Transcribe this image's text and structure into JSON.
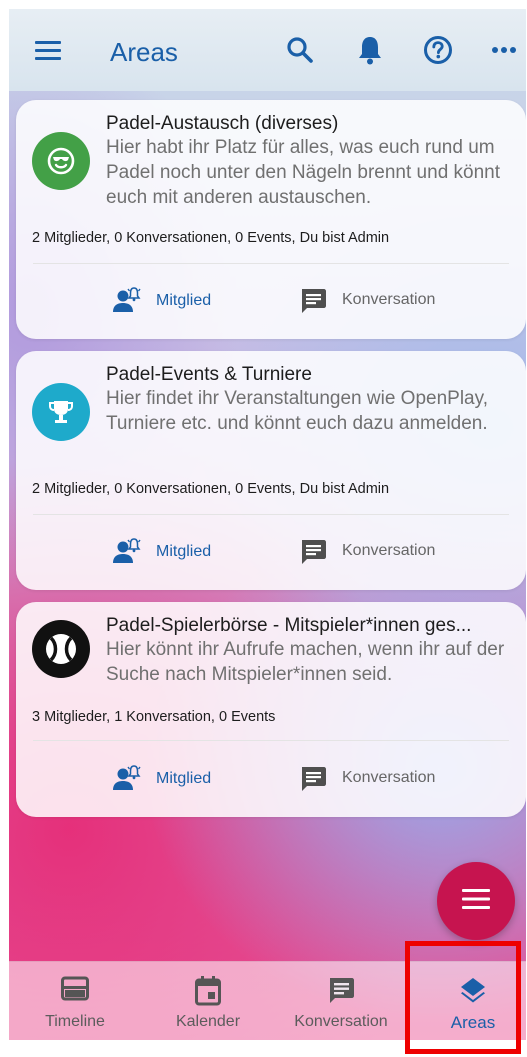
{
  "header": {
    "title": "Areas",
    "menu_icon": "hamburger-menu-icon",
    "search_icon": "search-icon",
    "notification_icon": "bell-icon",
    "help_icon": "help-circle-icon",
    "more_icon": "more-horizontal-icon"
  },
  "areas": [
    {
      "title": "Padel-Austausch (diverses)",
      "description": "Hier habt ihr Platz für alles, was euch rund um Padel noch unter den Nägeln brennt und könnt euch mit anderen austauschen.",
      "meta": "2 Mitglieder, 0 Konversationen, 0 Events, Du bist Admin",
      "avatar_color": "#43a047",
      "avatar_icon": "cool-face-icon",
      "member_label": "Mitglied",
      "conversation_label": "Konversation"
    },
    {
      "title": "Padel-Events & Turniere",
      "description": "Hier findet ihr Veranstaltungen wie OpenPlay, Turniere etc. und könnt euch dazu anmelden.",
      "meta": "2 Mitglieder, 0 Konversationen, 0 Events, Du bist Admin",
      "avatar_color": "#1eaacb",
      "avatar_icon": "trophy-icon",
      "member_label": "Mitglied",
      "conversation_label": "Konversation"
    },
    {
      "title": "Padel-Spielerbörse - Mitspieler*innen ges...",
      "description": "Hier könnt ihr Aufrufe machen, wenn ihr auf der Suche nach Mitspieler*innen seid.",
      "meta": "3 Mitglieder, 1 Konversation, 0 Events",
      "avatar_color": "#111111",
      "avatar_icon": "tennis-ball-icon",
      "member_label": "Mitglied",
      "conversation_label": "Konversation"
    }
  ],
  "fab": {
    "icon": "menu-icon"
  },
  "bottom_nav": [
    {
      "label": "Timeline",
      "icon": "timeline-icon",
      "active": false
    },
    {
      "label": "Kalender",
      "icon": "calendar-icon",
      "active": false
    },
    {
      "label": "Konversation",
      "icon": "chat-icon",
      "active": false
    },
    {
      "label": "Areas",
      "icon": "layers-icon",
      "active": true
    }
  ],
  "colors": {
    "accent": "#1a5fa8",
    "fab": "#c6144f",
    "highlight": "#ee0000"
  }
}
